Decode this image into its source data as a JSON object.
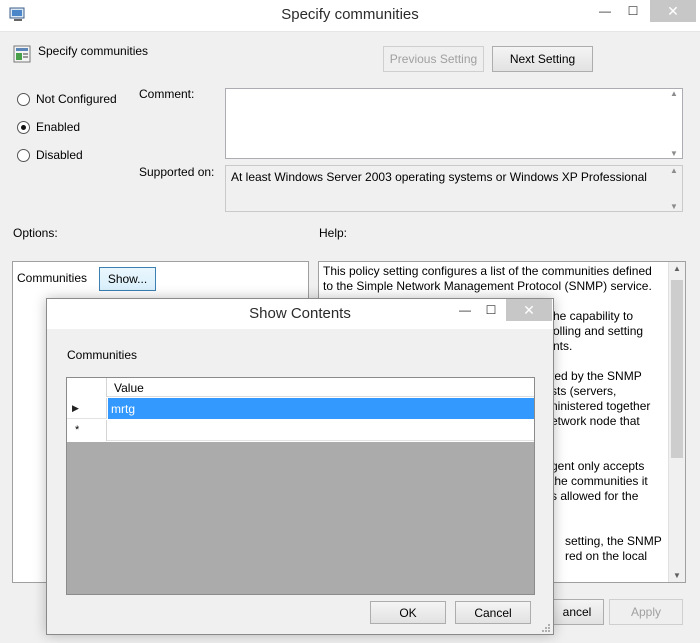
{
  "window": {
    "title": "Specify communities",
    "controls": {
      "minimize": "—",
      "maximize": "☐",
      "close": "✕"
    }
  },
  "header": {
    "policy_name": "Specify communities",
    "previous_label": "Previous Setting",
    "next_label": "Next Setting"
  },
  "state_options": [
    {
      "label": "Not Configured",
      "checked": false
    },
    {
      "label": "Enabled",
      "checked": true
    },
    {
      "label": "Disabled",
      "checked": false
    }
  ],
  "comment": {
    "label": "Comment:",
    "value": ""
  },
  "supported": {
    "label": "Supported on:",
    "value": "At least Windows Server 2003 operating systems or Windows XP Professional"
  },
  "options": {
    "label": "Options:",
    "communities_label": "Communities",
    "show_label": "Show..."
  },
  "help": {
    "label": "Help:",
    "line1": "This policy setting configures a list of the communities defined",
    "line2": "to the Simple Network Management Protocol (SNMP) service.",
    "frag1": "he capability to\nolling and setting\nnts.",
    "frag2": "ted by the SNMP\nsts (servers,\nninistered together\network node that",
    "frag3": "gent only accepts\n the communities it\ns allowed for the",
    "frag4": "setting, the SNMP\nred on the local"
  },
  "footer": {
    "cancel_fragment": "ancel",
    "apply_label": "Apply"
  },
  "dialog": {
    "title": "Show Contents",
    "section_label": "Communities",
    "column_header": "Value",
    "rows": [
      {
        "value": "mrtg",
        "selected": true
      }
    ],
    "new_row_marker": "*",
    "ok_label": "OK",
    "cancel_label": "Cancel"
  },
  "colors": {
    "selection": "#3399ff",
    "accent": "#0078d7"
  },
  "icons": {
    "policy": "policy-icon",
    "app": "app-icon"
  }
}
